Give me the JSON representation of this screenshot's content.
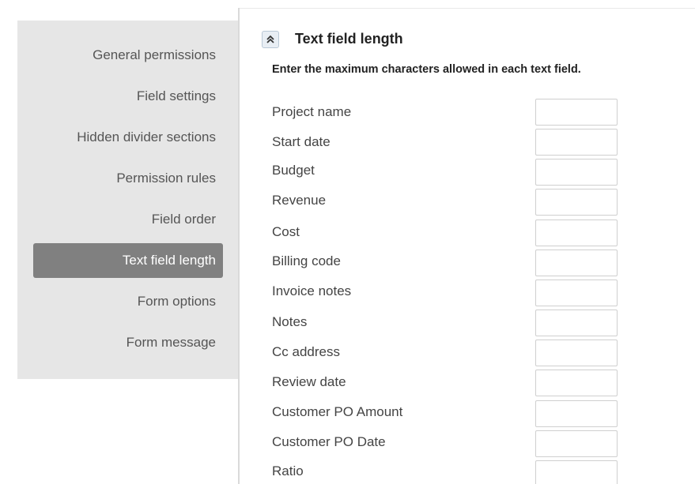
{
  "sidebar": {
    "items": [
      {
        "label": "General permissions",
        "active": false
      },
      {
        "label": "Field settings",
        "active": false
      },
      {
        "label": "Hidden divider sections",
        "active": false
      },
      {
        "label": "Permission rules",
        "active": false
      },
      {
        "label": "Field order",
        "active": false
      },
      {
        "label": "Text field length",
        "active": true
      },
      {
        "label": "Form options",
        "active": false
      },
      {
        "label": "Form message",
        "active": false
      }
    ]
  },
  "section": {
    "title": "Text field length",
    "collapse_icon": "double-chevron-up-icon",
    "description": "Enter the maximum characters allowed in each text field."
  },
  "fields": [
    {
      "label": "Project name",
      "value": ""
    },
    {
      "label": "Start date",
      "value": ""
    },
    {
      "label": "Budget",
      "value": ""
    },
    {
      "label": "Revenue",
      "value": ""
    },
    {
      "label": "Cost",
      "value": ""
    },
    {
      "label": "Billing code",
      "value": ""
    },
    {
      "label": "Invoice notes",
      "value": ""
    },
    {
      "label": "Notes",
      "value": ""
    },
    {
      "label": "Cc address",
      "value": ""
    },
    {
      "label": "Review date",
      "value": ""
    },
    {
      "label": "Customer PO Amount",
      "value": ""
    },
    {
      "label": "Customer PO Date",
      "value": ""
    },
    {
      "label": "Ratio",
      "value": ""
    }
  ],
  "colors": {
    "sidebar_bg": "#e6e6e6",
    "active_item_bg": "#808080",
    "active_item_text": "#ffffff",
    "nav_text": "#555555",
    "field_border": "#cfcfcf"
  }
}
